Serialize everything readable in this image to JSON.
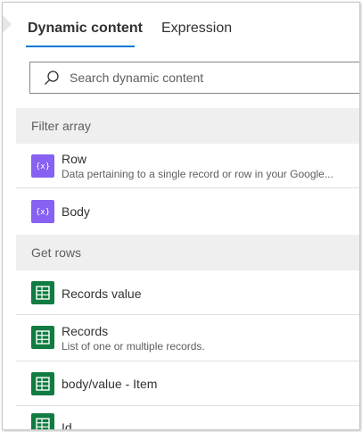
{
  "tabs": [
    {
      "label": "Dynamic content",
      "active": true
    },
    {
      "label": "Expression",
      "active": false
    }
  ],
  "search": {
    "placeholder": "Search dynamic content",
    "value": ""
  },
  "sections": [
    {
      "header": "Filter array",
      "items": [
        {
          "title": "Row",
          "description": "Data pertaining to a single record or row in your Google...",
          "icon": "variable-icon"
        },
        {
          "title": "Body",
          "description": "",
          "icon": "variable-icon"
        }
      ]
    },
    {
      "header": "Get rows",
      "items": [
        {
          "title": "Records value",
          "description": "",
          "icon": "google-sheets-icon"
        },
        {
          "title": "Records",
          "description": "List of one or multiple records.",
          "icon": "google-sheets-icon"
        },
        {
          "title": "body/value - Item",
          "description": "",
          "icon": "google-sheets-icon"
        },
        {
          "title": "Id",
          "description": "",
          "icon": "google-sheets-icon"
        }
      ]
    }
  ],
  "colors": {
    "accent": "#0078d4",
    "variable_icon": "#8661f2",
    "sheets_icon": "#107c41",
    "section_bg": "#efefef"
  }
}
